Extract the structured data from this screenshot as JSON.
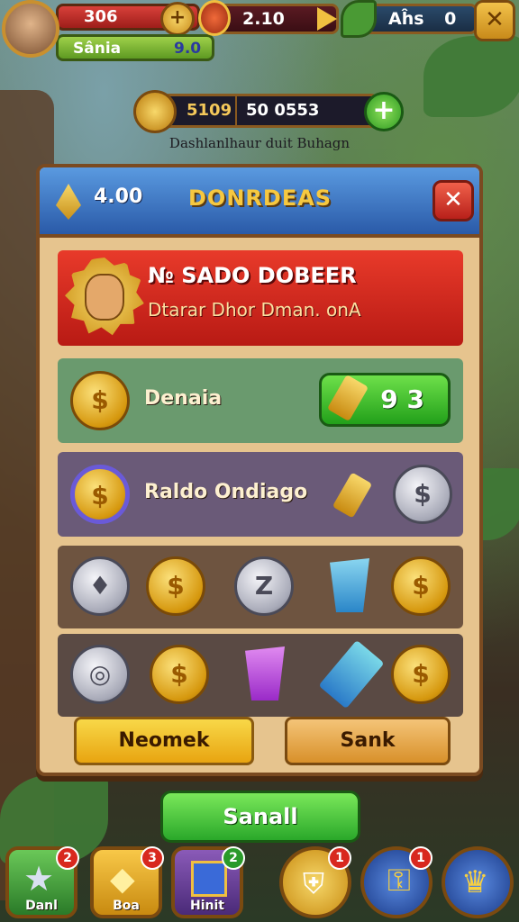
{
  "hud": {
    "hp_value": "306",
    "player_name": "Sânia",
    "player_score": "9.0",
    "resource_value": "2.10",
    "leaves_label": "Aĥs",
    "leaves_value": "0"
  },
  "currency": {
    "amount_a": "5109",
    "amount_b": "50 0553",
    "subtitle": "Dashlanlhaur duit Buhagn"
  },
  "panel": {
    "header_value": "4.00",
    "title": "DONRDEAS",
    "banner_title": "№ SADO DOBEER",
    "banner_subtitle": "Dtarar Dhor Dman. onA",
    "row1_label": "Denaia",
    "row1_price": "9 3",
    "row2_label": "Raldo Ondiago",
    "btn_left": "Neomek",
    "btn_right": "Sank"
  },
  "send_button": "Sanall",
  "nav": [
    {
      "label": "Danl",
      "badge": "2",
      "icon": "star-icon"
    },
    {
      "label": "Boa",
      "badge": "3",
      "icon": "gem-icon"
    },
    {
      "label": "Hinit",
      "badge": "2",
      "icon": "book-icon"
    },
    {
      "label": "",
      "badge": "1",
      "icon": "shield-icon"
    },
    {
      "label": "",
      "badge": "1",
      "icon": "key-icon"
    },
    {
      "label": "",
      "badge": "",
      "icon": "crown-icon"
    }
  ],
  "colors": {
    "panel": "#e6c48e",
    "header_blue": "#2a5aa8",
    "banner_red": "#d82a1e",
    "buy_green": "#22a01a"
  }
}
